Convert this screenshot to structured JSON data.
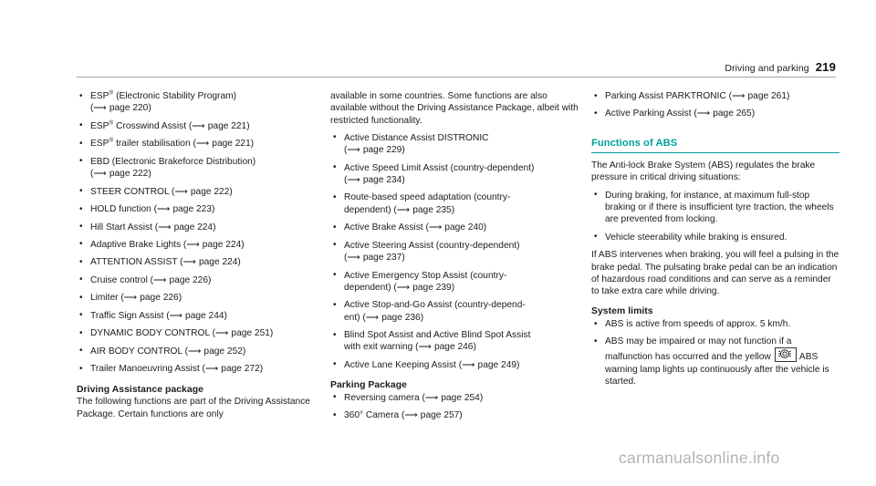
{
  "header": {
    "title": "Driving and parking",
    "page_number": "219"
  },
  "column1": {
    "items": [
      {
        "pre": "ESP",
        "sup": "®",
        "post": " (Electronic Stability Program)",
        "ref": "(⟶ page 220)",
        "ref_own_line": true
      },
      {
        "pre": "ESP",
        "sup": "®",
        "post": " Crosswind Assist (⟶ page 221)",
        "ref": "",
        "ref_own_line": false
      },
      {
        "pre": "ESP",
        "sup": "®",
        "post": " trailer stabilisation (⟶ page 221)",
        "ref": "",
        "ref_own_line": false
      },
      {
        "pre": "EBD (Electronic Brakeforce Distribution)",
        "sup": "",
        "post": "",
        "ref": "(⟶ page 222)",
        "ref_own_line": true
      },
      {
        "pre": "STEER CONTROL (⟶ page 222)",
        "sup": "",
        "post": "",
        "ref": "",
        "ref_own_line": false
      },
      {
        "pre": "HOLD function (⟶ page 223)",
        "sup": "",
        "post": "",
        "ref": "",
        "ref_own_line": false
      },
      {
        "pre": "Hill Start Assist (⟶ page 224)",
        "sup": "",
        "post": "",
        "ref": "",
        "ref_own_line": false
      },
      {
        "pre": "Adaptive Brake Lights (⟶ page 224)",
        "sup": "",
        "post": "",
        "ref": "",
        "ref_own_line": false
      },
      {
        "pre": "ATTENTION ASSIST (⟶ page 224)",
        "sup": "",
        "post": "",
        "ref": "",
        "ref_own_line": false
      },
      {
        "pre": "Cruise control (⟶ page 226)",
        "sup": "",
        "post": "",
        "ref": "",
        "ref_own_line": false
      },
      {
        "pre": "Limiter (⟶ page 226)",
        "sup": "",
        "post": "",
        "ref": "",
        "ref_own_line": false
      },
      {
        "pre": "Traffic Sign Assist (⟶ page 244)",
        "sup": "",
        "post": "",
        "ref": "",
        "ref_own_line": false
      },
      {
        "pre": "DYNAMIC BODY CONTROL (⟶ page 251)",
        "sup": "",
        "post": "",
        "ref": "",
        "ref_own_line": false
      },
      {
        "pre": "AIR BODY CONTROL (⟶ page 252)",
        "sup": "",
        "post": "",
        "ref": "",
        "ref_own_line": false
      },
      {
        "pre": "Trailer Manoeuvring Assist (⟶ page 272)",
        "sup": "",
        "post": "",
        "ref": "",
        "ref_own_line": false
      }
    ],
    "heading": "Driving Assistance package",
    "paragraph": "The following functions are part of the Driving Assistance Package. Certain functions are only"
  },
  "column2": {
    "paragraph_continued": "available in some countries. Some functions are also available without the Driving Assistance Package, albeit with restricted functionality.",
    "items": [
      {
        "text": "Active Distance Assist DISTRONIC",
        "ref": "(⟶ page 229)",
        "ref_own_line": true
      },
      {
        "text": "Active Speed Limit Assist (country-dependent)",
        "ref": "(⟶ page 234)",
        "ref_own_line": true
      },
      {
        "text": "Route-based speed adaptation (country-",
        "ref": "dependent) (⟶ page 235)",
        "ref_own_line": true
      },
      {
        "text": "Active Brake Assist (⟶ page 240)",
        "ref": "",
        "ref_own_line": false
      },
      {
        "text": "Active Steering Assist (country-dependent)",
        "ref": "(⟶ page 237)",
        "ref_own_line": true
      },
      {
        "text": "Active Emergency Stop Assist (country-",
        "ref": "dependent) (⟶ page 239)",
        "ref_own_line": true
      },
      {
        "text": "Active Stop-and-Go Assist (country-depend-",
        "ref": "ent) (⟶ page 236)",
        "ref_own_line": true
      },
      {
        "text": "Blind Spot Assist and Active Blind Spot Assist",
        "ref": "with exit warning (⟶ page 246)",
        "ref_own_line": true
      },
      {
        "text": "Active Lane Keeping Assist (⟶ page 249)",
        "ref": "",
        "ref_own_line": false
      }
    ],
    "heading": "Parking Package",
    "parking_items": [
      "Reversing camera (⟶ page 254)",
      "360° Camera (⟶ page 257)"
    ]
  },
  "column3": {
    "items": [
      "Parking Assist PARKTRONIC (⟶ page 261)",
      "Active Parking Assist (⟶ page 265)"
    ],
    "section_heading": "Functions of ABS",
    "intro": "The Anti-lock Brake System (ABS) regulates the brake pressure in critical driving situations:",
    "abs_items": [
      "During braking, for instance, at maximum full-stop braking or if there is insufficient tyre traction, the wheels are prevented from locking.",
      "Vehicle steerability while braking is ensured."
    ],
    "body": "If ABS intervenes when braking, you will feel a pulsing in the brake pedal. The pulsating brake pedal can be an indication of hazardous road conditions and can serve as a reminder to take extra care while driving.",
    "limits_heading": "System limits",
    "limit1": "ABS is active from speeds of approx. 5 km/h.",
    "limit2_part1": "ABS may be impaired or may not function if a malfunction has occurred and the yellow",
    "limit2_part2": "ABS warning lamp lights up continuously after the vehicle is started.",
    "lamp_icon_name": "abs-warning-lamp-icon"
  },
  "watermark": "carmanualsonline.info",
  "colors": {
    "accent_teal": "#00a09b",
    "text": "#1c1c1c",
    "rule": "#9aa8a4",
    "watermark": "#b3b3b3"
  }
}
